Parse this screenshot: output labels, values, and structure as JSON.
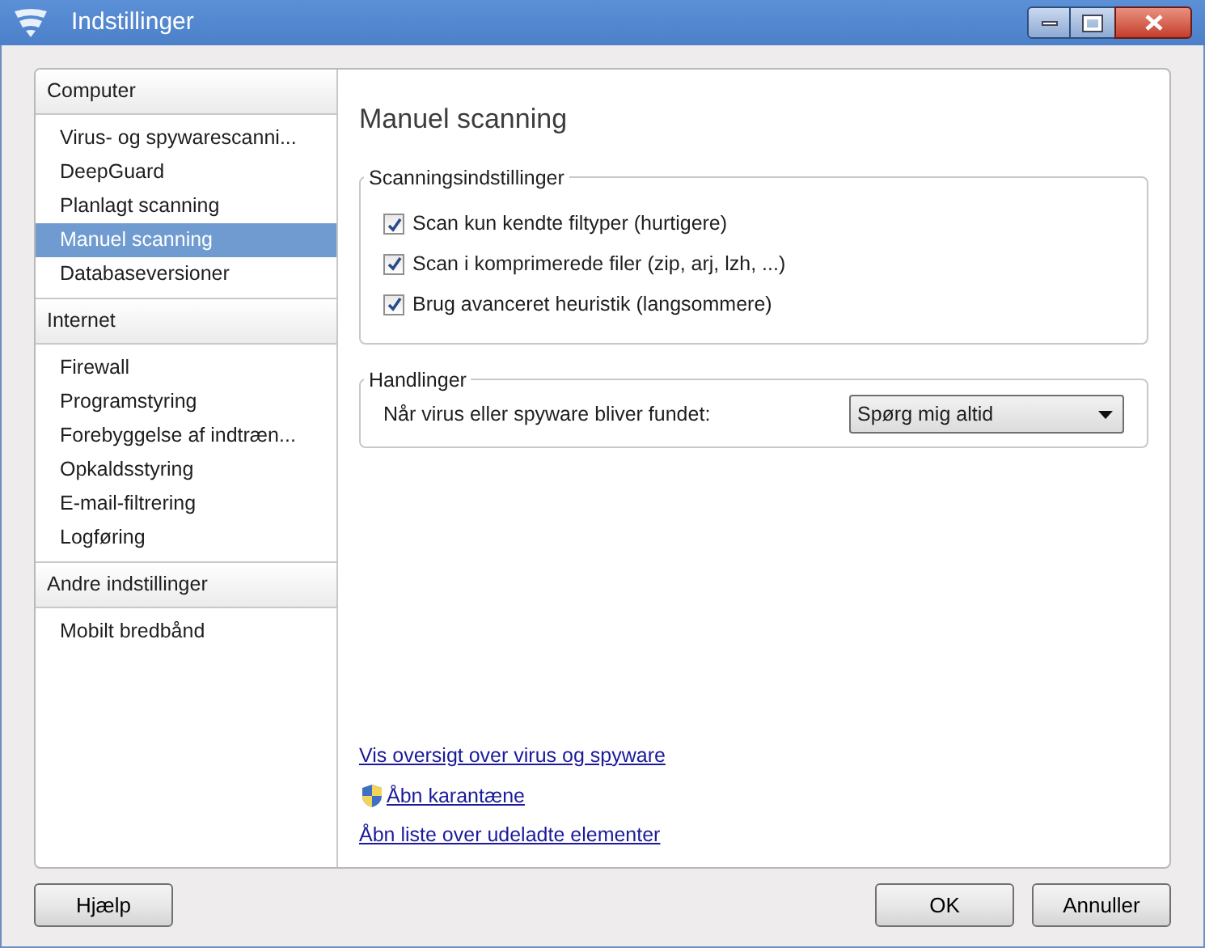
{
  "window": {
    "title": "Indstillinger"
  },
  "sidebar": {
    "groups": [
      {
        "header": "Computer",
        "items": [
          {
            "label": "Virus- og spywarescanni...",
            "selected": false
          },
          {
            "label": "DeepGuard",
            "selected": false
          },
          {
            "label": "Planlagt scanning",
            "selected": false
          },
          {
            "label": "Manuel scanning",
            "selected": true
          },
          {
            "label": "Databaseversioner",
            "selected": false
          }
        ]
      },
      {
        "header": "Internet",
        "items": [
          {
            "label": "Firewall",
            "selected": false
          },
          {
            "label": "Programstyring",
            "selected": false
          },
          {
            "label": "Forebyggelse af indtræn...",
            "selected": false
          },
          {
            "label": "Opkaldsstyring",
            "selected": false
          },
          {
            "label": "E-mail-filtrering",
            "selected": false
          },
          {
            "label": "Logføring",
            "selected": false
          }
        ]
      },
      {
        "header": "Andre indstillinger",
        "items": [
          {
            "label": "Mobilt bredbånd",
            "selected": false
          }
        ]
      }
    ]
  },
  "content": {
    "title": "Manuel scanning",
    "scan_settings": {
      "legend": "Scanningsindstillinger",
      "options": [
        {
          "label": "Scan kun kendte filtyper (hurtigere)",
          "checked": true
        },
        {
          "label": "Scan i komprimerede filer (zip, arj, lzh, ...)",
          "checked": true
        },
        {
          "label": "Brug avanceret heuristik (langsommere)",
          "checked": true
        }
      ]
    },
    "actions": {
      "legend": "Handlinger",
      "label": "Når virus eller spyware bliver fundet:",
      "dropdown": "Spørg mig altid"
    },
    "links": [
      {
        "label": "Vis oversigt over virus og spyware",
        "kind": "plain"
      },
      {
        "label": "Åbn karantæne",
        "kind": "admin"
      },
      {
        "label": "Åbn liste over udeladte elementer",
        "kind": "plain"
      }
    ]
  },
  "buttons": {
    "left": [
      "Hjælp"
    ],
    "right": [
      "OK",
      "Annuller"
    ]
  }
}
